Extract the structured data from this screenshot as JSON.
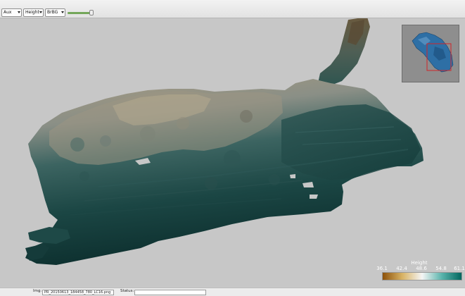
{
  "toolbar": {
    "view_select": "Aux",
    "attribute_select": "Height",
    "colormap_select": "BrBG",
    "slider_level": 0.95
  },
  "colorbar": {
    "title": "Height",
    "ticks": [
      "36.1",
      "42.4",
      "48.6",
      "54.8",
      "61.1"
    ],
    "stops": [
      "#8c510a",
      "#d8b365",
      "#f5f5f5",
      "#5ab4ac",
      "#01665e"
    ]
  },
  "statusbar": {
    "img_label": "Img:",
    "img_value": "PR_20150613_184458_780_LC16.png",
    "status_label": "Status:",
    "status_value": ""
  },
  "colors": {
    "background": "#c7c7c7",
    "surface_dark": "#0f3533",
    "surface_light": "#b7a98e",
    "minimap_mesh": "#2e6fa5",
    "minimap_frame": "#d0252a"
  }
}
